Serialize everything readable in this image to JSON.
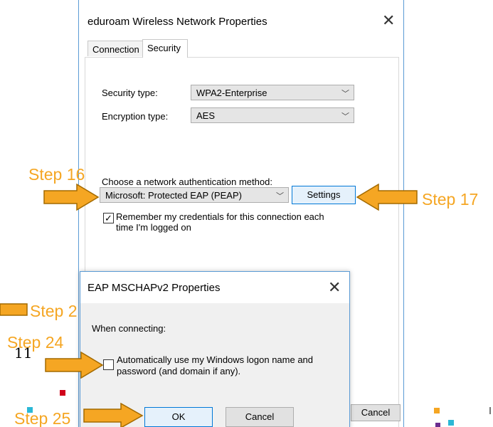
{
  "main_window": {
    "title": "eduroam Wireless Network Properties",
    "close_glyph": "✕",
    "tabs": [
      {
        "label": "Connection",
        "active": false
      },
      {
        "label": "Security",
        "active": true
      }
    ],
    "security_type_label": "Security type:",
    "security_type_value": "WPA2-Enterprise",
    "encryption_type_label": "Encryption type:",
    "encryption_type_value": "AES",
    "auth_method_label": "Choose a network authentication method:",
    "auth_method_value": "Microsoft: Protected EAP (PEAP)",
    "settings_button": "Settings",
    "remember_checked": true,
    "remember_label_line1": "Remember my credentials for this connection each",
    "remember_label_line2": "time I'm logged on",
    "cancel_button": "Cancel"
  },
  "eap_dialog": {
    "title": "EAP MSCHAPv2 Properties",
    "close_glyph": "✕",
    "when_connecting": "When connecting:",
    "auto_logon_checked": false,
    "auto_logon_line1": "Automatically use my Windows logon name and",
    "auto_logon_line2": "password (and domain if any).",
    "ok_button": "OK",
    "cancel_button": "Cancel"
  },
  "annotations": {
    "step16": "Step 16",
    "step17": "Step 17",
    "step2x": "Step 2",
    "step24": "Step 24",
    "step25": "Step 25",
    "stray_number": "11",
    "arrow_color": "#f5a623",
    "arrow_outline": "#a36a00"
  },
  "colors": {
    "window_border": "#5b9bd5",
    "button_focus_border": "#0078d7",
    "dialog_body": "#f0f0f0"
  },
  "icons": {
    "chevron": "chevron-down-icon",
    "close": "close-icon",
    "check": "checkmark-icon"
  }
}
